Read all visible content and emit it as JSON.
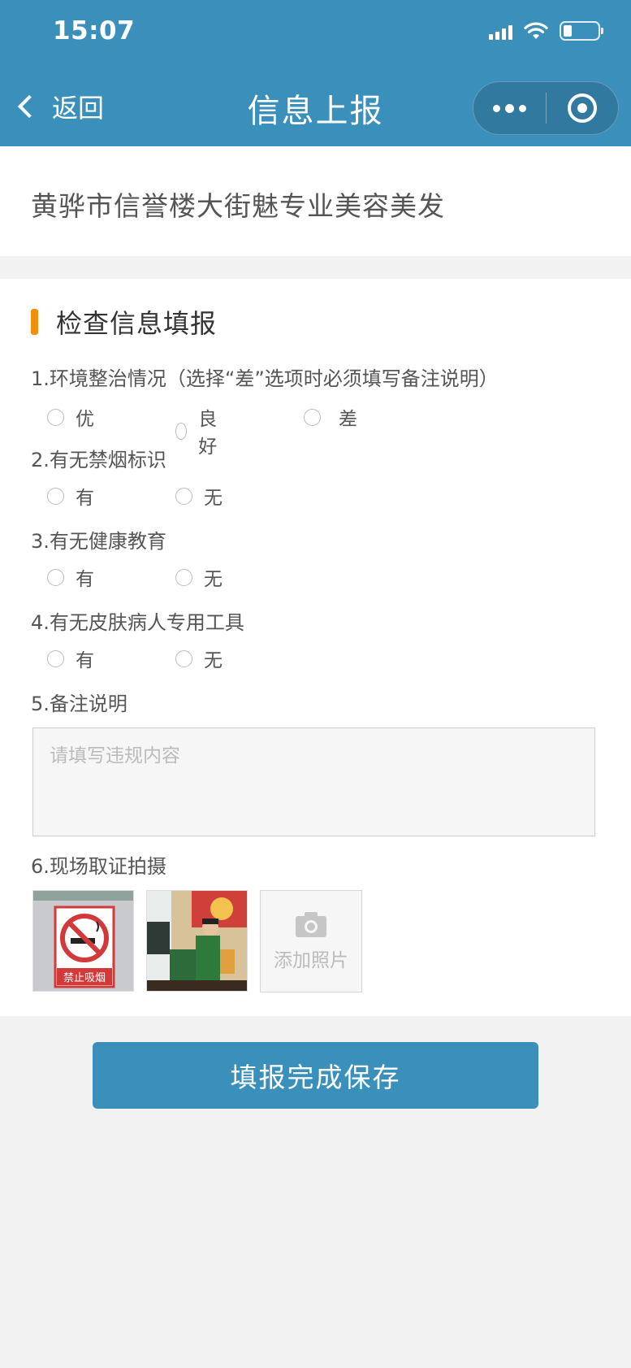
{
  "status_bar": {
    "time": "15:07",
    "signal_icon": "signal-icon",
    "wifi_icon": "wifi-icon",
    "battery_icon": "battery-icon"
  },
  "nav": {
    "back_label": "返回",
    "title": "信息上报",
    "more_icon": "more-icon",
    "close_icon": "target-icon"
  },
  "shop": {
    "name": "黄骅市信誉楼大街魅专业美容美发"
  },
  "section": {
    "title": "检查信息填报",
    "accent_color": "#f0900c"
  },
  "questions": [
    {
      "label": "1.环境整治情况（选择“差”选项时必须填写备注说明）",
      "options": [
        "优",
        "良好",
        "差"
      ]
    },
    {
      "label": "2.有无禁烟标识",
      "options": [
        "有",
        "无"
      ]
    },
    {
      "label": "3.有无健康教育",
      "options": [
        "有",
        "无"
      ]
    },
    {
      "label": "4.有无皮肤病人专用工具",
      "options": [
        "有",
        "无"
      ]
    }
  ],
  "remark": {
    "label": "5.备注说明",
    "placeholder": "请填写违规内容",
    "value": ""
  },
  "photos": {
    "label": "6.现场取证拍摄",
    "items": [
      {
        "name": "no-smoking-sign-photo",
        "sign_text": "禁止吸烟"
      },
      {
        "name": "shop-staff-photo"
      }
    ],
    "add_label": "添加照片",
    "add_icon": "camera-icon"
  },
  "submit": {
    "label": "填报完成保存"
  },
  "colors": {
    "primary": "#3b8fbb",
    "background": "#f2f2f2"
  }
}
